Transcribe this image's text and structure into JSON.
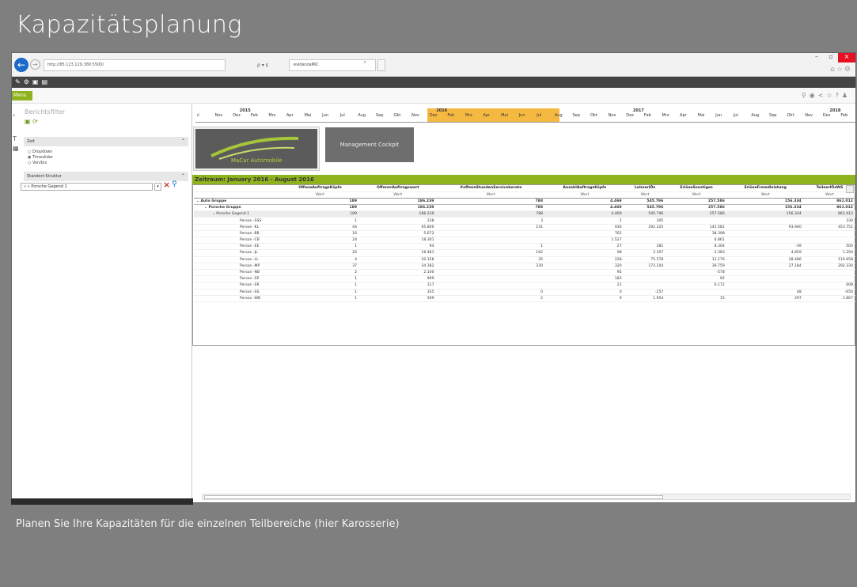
{
  "slide": {
    "title": "Kapazitätsplanung",
    "caption": "Planen Sie Ihre Kapazitäten für die einzelnen Teilbereiche (hier Karosserie)"
  },
  "browser": {
    "address": "http://85.123.129.380:5500/",
    "address_controls": "ρ ▾ ¢",
    "tab_title": "evidanzaMiC",
    "tab_close": "×"
  },
  "app": {
    "menu_label": "Menu",
    "panel_title": "Berichtsfilter",
    "sections": {
      "time": "Zeit",
      "structure": "Standort-Struktur"
    },
    "time_options": [
      "Dropdown",
      "Timeslider",
      "Von/bis"
    ],
    "filter_value": "« » Porsche Gegend 1"
  },
  "timeline": {
    "labels": [
      "ıl",
      "Nov",
      "Dez",
      "Feb",
      "Mrz",
      "Apr",
      "Mai",
      "Jun",
      "Jul",
      "Aug",
      "Sep",
      "Okt",
      "Nov",
      "Dez",
      "Feb",
      "Mrz",
      "Apr",
      "Mai",
      "Jun",
      "Jul",
      "Aug",
      "Sep",
      "Okt",
      "Nov",
      "Dez",
      "Feb",
      "Mrz",
      "Apr",
      "Mai",
      "Jun",
      "Jul",
      "Aug",
      "Sep",
      "Okt",
      "Nov",
      "Dez",
      "Feb"
    ],
    "years": [
      "2015",
      "2016",
      "2017",
      "2018"
    ]
  },
  "tiles": {
    "logo_text": "MaCar Automobile",
    "cockpit": "Management Cockpit"
  },
  "report": {
    "period": "Zeitraum: January 2016 - August 2016",
    "columns": [
      "OffeneAuftragsKöpfe",
      "OffenerAuftragswert",
      "#offeneStundenServiceberate",
      "AnzahlAuftragsKöpfe",
      "LohnerlÖs",
      "ErlöseSonstiges",
      "ErlöseFremdleistung",
      "TeileerlÖsWS"
    ],
    "subheader": "Wert",
    "rows": [
      {
        "name": "⌄ Auto Gruppe",
        "level": 0,
        "vals": [
          "189",
          "186.239",
          "788",
          "4.469",
          "545.796",
          "257.586",
          "156.334",
          "861.012"
        ]
      },
      {
        "name": "⌄ Porsche Gruppe",
        "level": 1,
        "vals": [
          "189",
          "186.239",
          "788",
          "4.469",
          "545.796",
          "257.586",
          "156.334",
          "861.012"
        ]
      },
      {
        "name": "⌄ Porsche Gegend 1",
        "level": 2,
        "vals": [
          "189",
          "186.239",
          "788",
          "4.469",
          "545.796",
          "257.586",
          "156.334",
          "861.012"
        ]
      },
      {
        "name": "Person -SSS",
        "level": 3,
        "vals": [
          "1",
          "238",
          "3",
          "1",
          "305",
          "",
          "",
          "330"
        ]
      },
      {
        "name": "Person -KL",
        "level": 3,
        "vals": [
          "44",
          "65.800",
          "231",
          "930",
          "292.325",
          "141.581",
          "93.940",
          "453.751"
        ]
      },
      {
        "name": "Person -BB",
        "level": 3,
        "vals": [
          "16",
          "5.672",
          "",
          "762",
          "",
          "38.398",
          "",
          ""
        ]
      },
      {
        "name": "Person -CB",
        "level": 3,
        "vals": [
          "24",
          "18.301",
          "",
          "1.527",
          "",
          "6.861",
          "",
          ""
        ]
      },
      {
        "name": "Person -EE",
        "level": 3,
        "vals": [
          "1",
          "94",
          "1",
          "27",
          "281",
          "8.304",
          "-39",
          "500"
        ]
      },
      {
        "name": "Person -JL",
        "level": 3,
        "vals": [
          "26",
          "18.461",
          "162",
          "98",
          "2.357",
          "2.383",
          "4.859",
          "1.294"
        ]
      },
      {
        "name": "Person -LL",
        "level": 3,
        "vals": [
          "4",
          "20.158",
          "35",
          "228",
          "75.578",
          "12.176",
          "28.486",
          "119.658"
        ]
      },
      {
        "name": "Person -MP",
        "level": 3,
        "vals": [
          "37",
          "34.182",
          "330",
          "320",
          "173.104",
          "39.759",
          "27.184",
          "292.330"
        ]
      },
      {
        "name": "Person -NB",
        "level": 3,
        "vals": [
          "2",
          "2.100",
          "",
          "95",
          "",
          "-578",
          "",
          ""
        ]
      },
      {
        "name": "Person -SP",
        "level": 3,
        "vals": [
          "1",
          "999",
          "",
          "183",
          "",
          "92",
          "",
          ""
        ]
      },
      {
        "name": "Person -SR",
        "level": 3,
        "vals": [
          "1",
          "117",
          "",
          "21",
          "",
          "6.172",
          "",
          "608"
        ]
      },
      {
        "name": "Person -SS",
        "level": 3,
        "vals": [
          "1",
          "335",
          "0",
          "0",
          "-257",
          "",
          "48",
          "-650"
        ]
      },
      {
        "name": "Person -WB",
        "level": 3,
        "vals": [
          "1",
          "599",
          "2",
          "9",
          "1.954",
          "15",
          "297",
          "1.867"
        ]
      }
    ]
  }
}
